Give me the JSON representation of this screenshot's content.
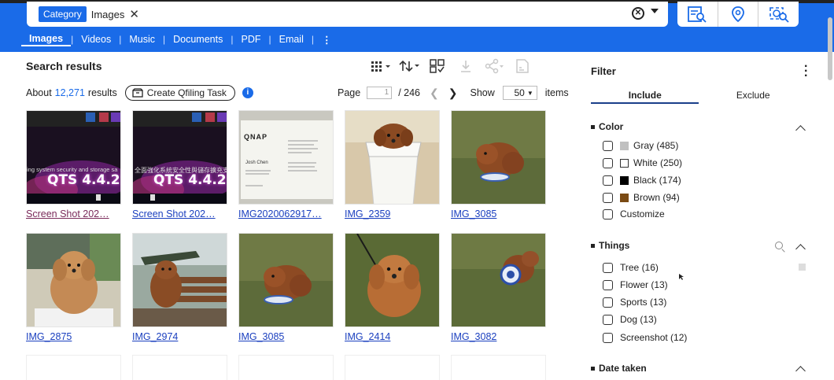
{
  "search": {
    "chip_label": "Category",
    "chip_value": "Images"
  },
  "nav": {
    "items": [
      "Images",
      "Videos",
      "Music",
      "Documents",
      "PDF",
      "Email"
    ]
  },
  "results": {
    "title": "Search results",
    "about_prefix": "About",
    "count": "12,271",
    "count_suffix": "results",
    "qfiling_label": "Create Qfiling Task",
    "info": "i"
  },
  "pager": {
    "page_label": "Page",
    "page_value": "1",
    "total": "/ 246",
    "show_label": "Show",
    "show_value": "50",
    "items_label": "items"
  },
  "tiles": [
    {
      "caption": "Screen Shot 202…",
      "thumb_text": "QTS 4.4.2",
      "sub_text": "ing system security and storage sa",
      "kind": "screen1"
    },
    {
      "caption": "Screen Shot 202…",
      "thumb_text": "QTS 4.4.2",
      "sub_text": "全面強化系統安全性與儲存擴充支",
      "kind": "screen2"
    },
    {
      "caption": "IMG2020062917…",
      "thumb_text": "QNAP",
      "sub_text": "Josh Chen",
      "kind": "card"
    },
    {
      "caption": "IMG_2359",
      "kind": "bin"
    },
    {
      "caption": "IMG_3085",
      "kind": "grass"
    },
    {
      "caption": "IMG_2875",
      "kind": "indoor"
    },
    {
      "caption": "IMG_2974",
      "kind": "bench"
    },
    {
      "caption": "IMG_3085",
      "kind": "grass"
    },
    {
      "caption": "IMG_2414",
      "kind": "grass2"
    },
    {
      "caption": "IMG_3082",
      "kind": "grass3"
    }
  ],
  "filter": {
    "title": "Filter",
    "tabs": [
      "Include",
      "Exclude"
    ],
    "color": {
      "title": "Color",
      "options": [
        {
          "label": "Gray (485)",
          "swatch": "#c0c0c0"
        },
        {
          "label": "White (250)",
          "swatch": "#ffffff"
        },
        {
          "label": "Black (174)",
          "swatch": "#000000"
        },
        {
          "label": "Brown (94)",
          "swatch": "#7a4a14"
        },
        {
          "label": "Customize"
        }
      ]
    },
    "things": {
      "title": "Things",
      "options": [
        "Tree (16)",
        "Flower (13)",
        "Sports (13)",
        "Dog (13)",
        "Screenshot (12)"
      ]
    },
    "date": {
      "title": "Date taken"
    }
  },
  "colors": {
    "accent": "#1a6be8",
    "link": "#1a3fbf"
  }
}
